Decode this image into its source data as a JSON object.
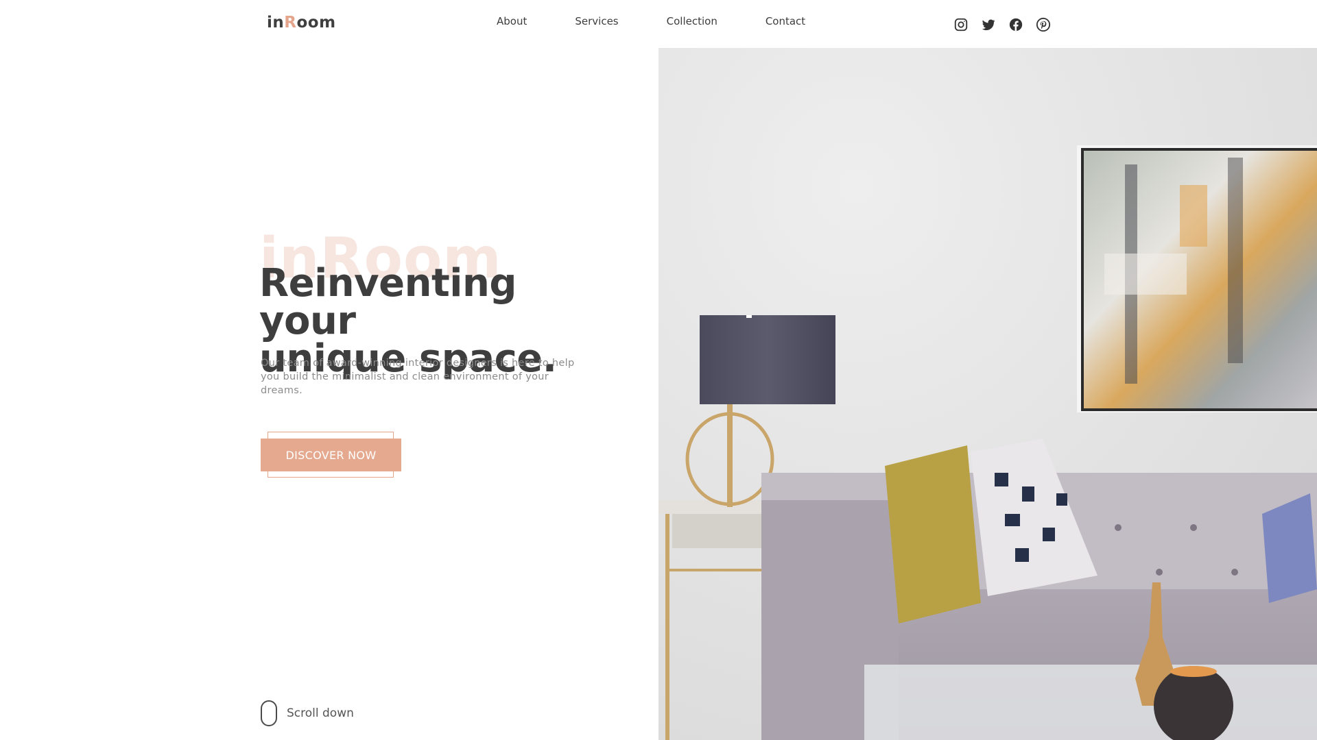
{
  "header": {
    "logo_part1": "in",
    "logo_accent": "R",
    "logo_part2": "oom",
    "nav": [
      {
        "label": "About"
      },
      {
        "label": "Services"
      },
      {
        "label": "Collection"
      },
      {
        "label": "Contact"
      }
    ],
    "socials": [
      "instagram-icon",
      "twitter-icon",
      "facebook-icon",
      "pinterest-icon"
    ]
  },
  "hero": {
    "watermark": "inRoom",
    "headline_line1": "Reinventing your",
    "headline_line2": "unique space.",
    "subtext": "Our team of award-winning interior designers is here to help you build the minimalist and clean environment of your dreams.",
    "cta_label": "DISCOVER NOW",
    "scroll_label": "Scroll down",
    "image": "living-room-photo"
  },
  "colors": {
    "accent": "#e5a98f",
    "text_dark": "#3e3e3e",
    "text_muted": "#8c8c8c"
  }
}
